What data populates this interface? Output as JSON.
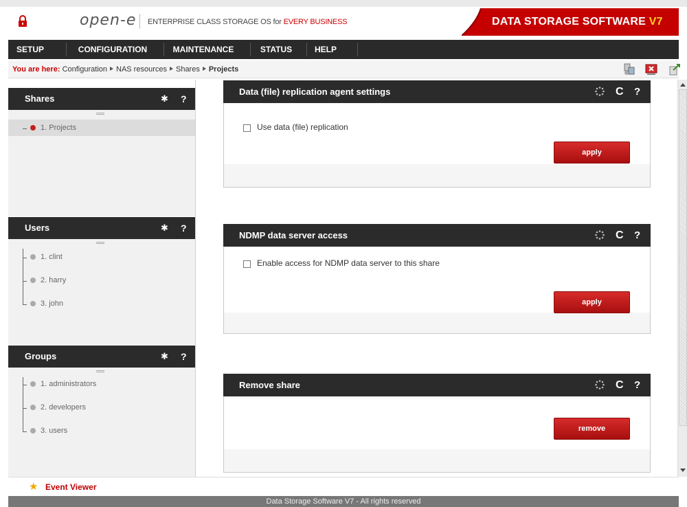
{
  "header": {
    "logo": "open-e",
    "tagline_prefix": "ENTERPRISE CLASS STORAGE OS for ",
    "tagline_highlight": "EVERY BUSINESS",
    "brand": "DATA STORAGE SOFTWARE ",
    "brand_version": "V7",
    "colors": {
      "accent_red": "#c40000",
      "nav_bg": "#2a2a2a",
      "version_yellow": "#ffd11a"
    }
  },
  "nav": {
    "items": [
      {
        "label": "SETUP"
      },
      {
        "label": "CONFIGURATION"
      },
      {
        "label": "MAINTENANCE"
      },
      {
        "label": "STATUS"
      },
      {
        "label": "HELP"
      }
    ]
  },
  "breadcrumb": {
    "prefix": "You are here:",
    "items": [
      "Configuration",
      "NAS resources",
      "Shares"
    ],
    "current": "Projects"
  },
  "toolbar_icons": [
    "network-icon",
    "close-window-icon",
    "logout-icon"
  ],
  "sidebar": {
    "shares": {
      "title": "Shares",
      "items": [
        {
          "label": "1. Projects",
          "selected": true
        }
      ]
    },
    "users": {
      "title": "Users",
      "items": [
        {
          "label": "1. clint"
        },
        {
          "label": "2. harry"
        },
        {
          "label": "3. john"
        }
      ]
    },
    "groups": {
      "title": "Groups",
      "items": [
        {
          "label": "1. administrators"
        },
        {
          "label": "2. developers"
        },
        {
          "label": "3. users"
        }
      ]
    },
    "gear_glyph": "✱",
    "help_glyph": "?"
  },
  "panels": {
    "replication": {
      "title": "Data (file) replication agent settings",
      "checkbox_label": "Use data (file) replication",
      "checked": false,
      "button": "apply"
    },
    "ndmp": {
      "title": "NDMP data server access",
      "checkbox_label": "Enable access for NDMP data server to this share",
      "checked": false,
      "button": "apply"
    },
    "remove": {
      "title": "Remove share",
      "button": "remove"
    },
    "refresh_glyph": "C",
    "help_glyph": "?"
  },
  "event_viewer": {
    "label": "Event Viewer"
  },
  "footer": {
    "text": "Data Storage Software V7 - All rights reserved"
  }
}
